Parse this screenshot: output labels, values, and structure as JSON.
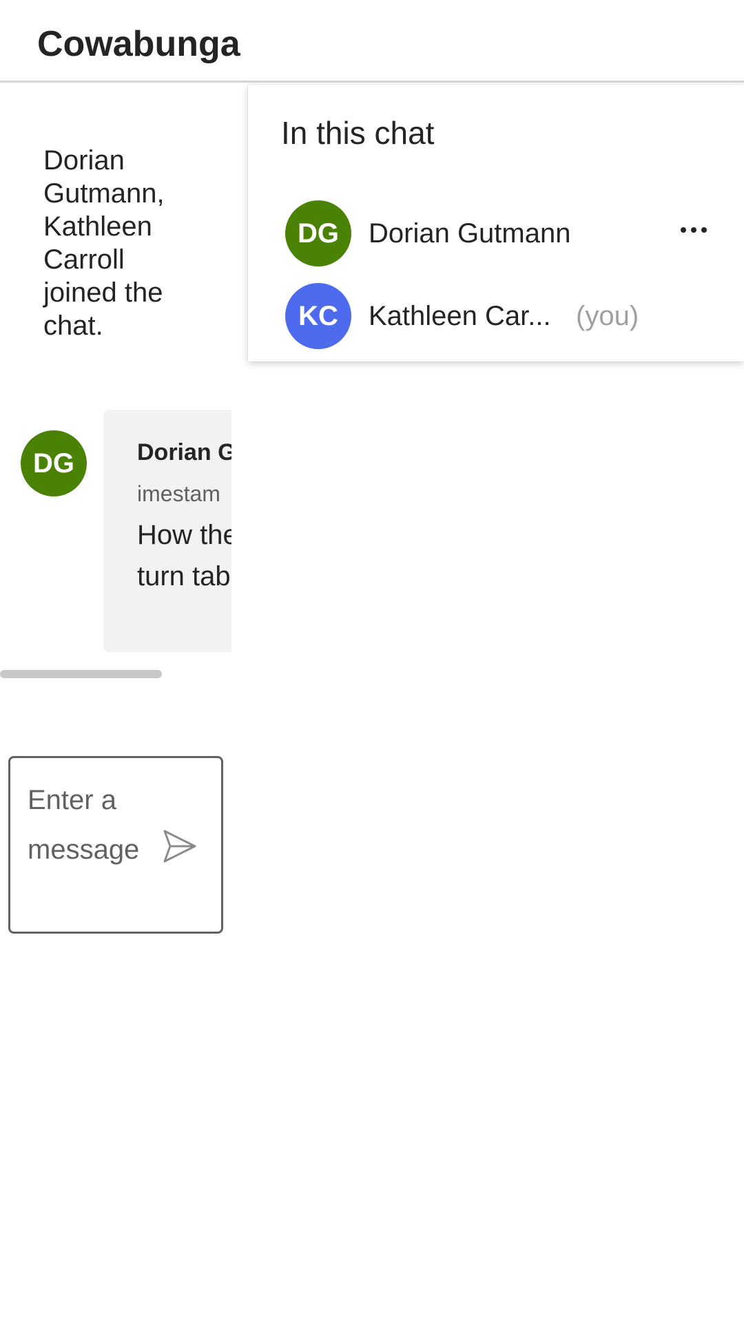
{
  "header": {
    "title": "Cowabunga"
  },
  "chat": {
    "system_message": "Dorian Gutmann, Kathleen Carroll joined the chat.",
    "messages": [
      {
        "avatar_initials": "DG",
        "avatar_color": "#498205",
        "sender": "Dorian Gutmann",
        "timestamp": "imestam",
        "text": "How the turn tab"
      }
    ]
  },
  "composer": {
    "placeholder": "Enter a message",
    "send_icon": "send-icon"
  },
  "participants_panel": {
    "title": "In this chat",
    "participants": [
      {
        "initials": "DG",
        "name": "Dorian Gutmann",
        "suffix": "",
        "avatar_color": "#498205",
        "more_icon": "more-options-icon"
      },
      {
        "initials": "KC",
        "name": "Kathleen Car...",
        "suffix": "(you)",
        "avatar_color": "#4f6bed"
      }
    ]
  }
}
